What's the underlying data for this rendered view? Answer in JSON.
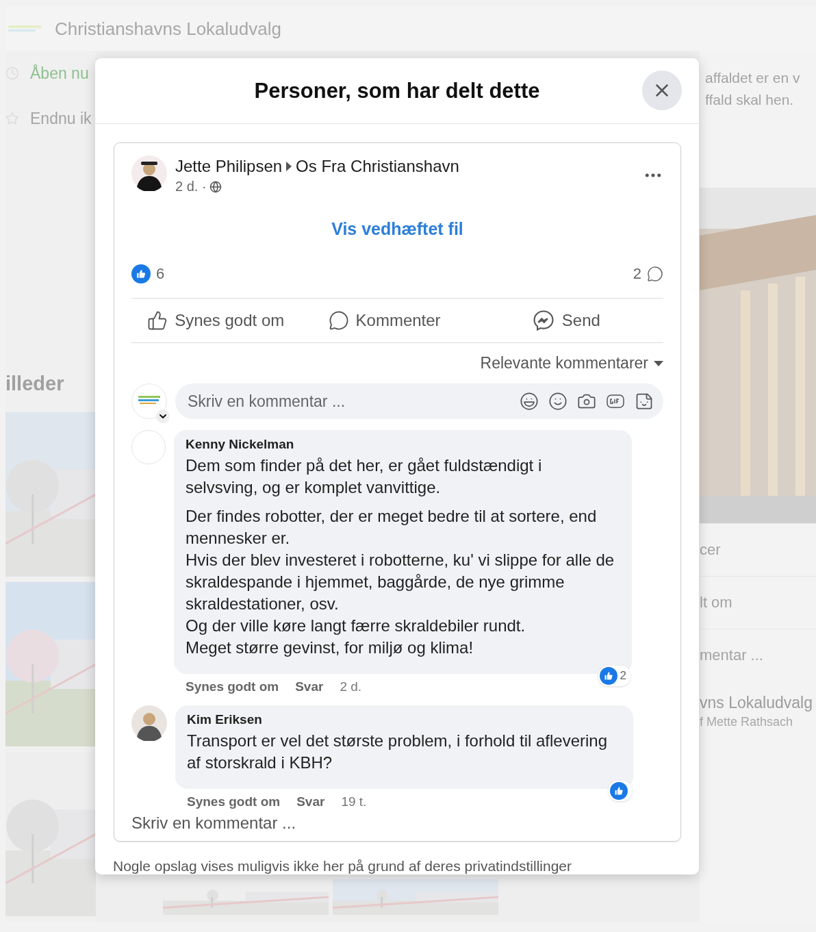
{
  "background": {
    "header_title": "Christianshavns Lokaludvalg",
    "left_items": [
      {
        "kind": "status",
        "label": "Åben nu"
      },
      {
        "kind": "rating",
        "label": "Endnu ik"
      }
    ],
    "left_heading": "illeder",
    "right_texts": [
      "affaldet er en v",
      "ffald skal hen."
    ],
    "right_rows": [
      "cer",
      "lt om",
      "mentar ..."
    ],
    "right_page": {
      "name": "vns Lokaludvalg",
      "byline": "f Mette Rathsach"
    }
  },
  "modal": {
    "title": "Personer, som har delt dette",
    "post": {
      "author": "Jette Philipsen",
      "group": "Os Fra Christianshavn",
      "time": "2 d. ·",
      "attachment_link": "Vis vedhæftet fil",
      "like_count": "6",
      "comment_count": "2",
      "actions": [
        {
          "kind": "like",
          "label": "Synes godt om"
        },
        {
          "kind": "comment",
          "label": "Kommenter"
        },
        {
          "kind": "send",
          "label": "Send"
        }
      ],
      "sort_label": "Relevante kommentarer",
      "comment_field": {
        "placeholder": "Skriv en kommentar ..."
      },
      "comments": [
        {
          "author": "Kenny Nickelman",
          "has_photo": false,
          "paragraphs": [
            "Dem som finder på det her, er gået fuldstændigt i selvsving, og er komplet vanvittige.",
            "Der findes robotter, der er meget bedre til at sortere, end mennesker er.\nHvis der blev investeret i robotterne, ku' vi slippe for alle de skraldespande i hjemmet, baggårde, de nye grimme skraldestationer, osv.\nOg der ville køre langt færre skraldebiler rundt.\nMeget større gevinst, for miljø og klima!"
          ],
          "reaction_count": "2",
          "like_label": "Synes godt om",
          "reply_label": "Svar",
          "time": "2 d."
        },
        {
          "author": "Kim Eriksen",
          "has_photo": true,
          "paragraphs": [
            "Transport er vel det største problem, i forhold til aflevering af storskrald i KBH?"
          ],
          "like_label": "Synes godt om",
          "reply_label": "Svar",
          "time": "19 t."
        }
      ],
      "write_comment": "Skriv en kommentar ..."
    },
    "footer_note": "Nogle opslag vises muligvis ikke her på grund af deres privatindstillinger"
  }
}
